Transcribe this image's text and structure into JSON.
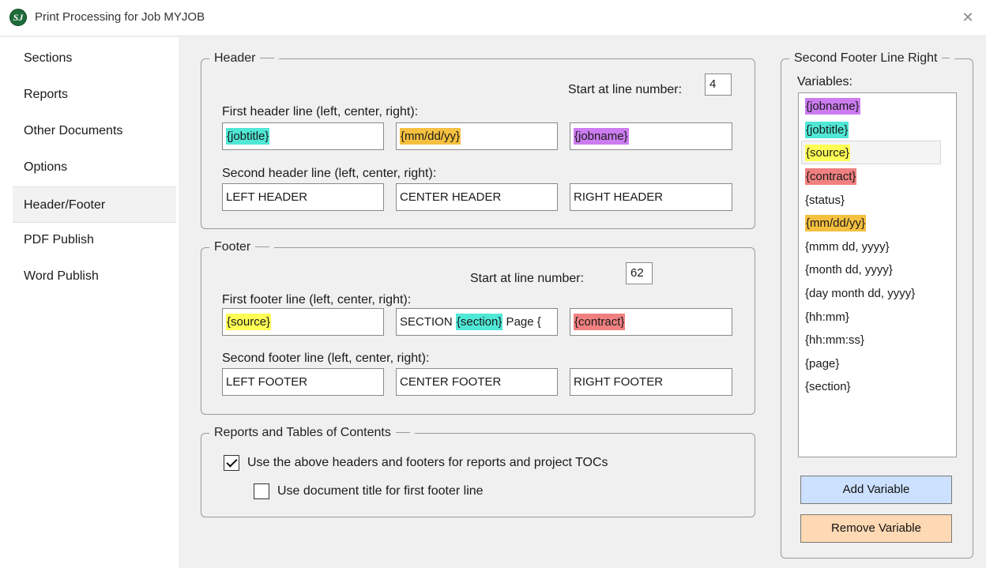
{
  "window": {
    "title": "Print Processing for Job MYJOB",
    "app_icon_text": "SJ",
    "close_glyph": "✕"
  },
  "sidebar": {
    "items": [
      {
        "label": "Sections"
      },
      {
        "label": "Reports"
      },
      {
        "label": "Other Documents"
      },
      {
        "label": "Options"
      },
      {
        "label": "Header/Footer"
      },
      {
        "label": "PDF Publish"
      },
      {
        "label": "Word Publish"
      }
    ],
    "active": "Header/Footer"
  },
  "colors": {
    "jobname": "#cc7cf0",
    "jobtitle": "#4fe8d6",
    "source": "#ffff55",
    "contract": "#f08080",
    "date": "#f5c040",
    "add_button": "#cce0ff",
    "remove_button": "#ffd9b3"
  },
  "header": {
    "legend": "Header",
    "start_label": "Start at line number:",
    "start_value": "4",
    "first_line_label": "First header line (left, center, right):",
    "first_left": "{jobtitle}",
    "first_center": "{mm/dd/yy}",
    "first_right": "{jobname}",
    "second_line_label": "Second header line (left, center, right):",
    "second_left": "LEFT HEADER",
    "second_center": "CENTER HEADER",
    "second_right": "RIGHT HEADER"
  },
  "footer": {
    "legend": "Footer",
    "start_label": "Start at line number:",
    "start_value": "62",
    "first_line_label": "First footer line (left, center, right):",
    "first_left": "{source}",
    "first_center_prefix": "SECTION ",
    "first_center_var": "{section}",
    "first_center_suffix": " Page {",
    "first_right": "{contract}",
    "second_line_label": "Second footer line (left, center, right):",
    "second_left": "LEFT FOOTER",
    "second_center": "CENTER FOOTER",
    "second_right": "RIGHT FOOTER"
  },
  "reports_toc": {
    "legend": "Reports and Tables of Contents",
    "use_headers_label": "Use the above headers and footers for reports and project TOCs",
    "use_headers_checked": true,
    "use_doc_title_label": "Use document title for first footer line",
    "use_doc_title_checked": false
  },
  "variables_panel": {
    "legend": "Second Footer Line Right",
    "variables_label": "Variables:",
    "items": [
      "{jobname}",
      "{jobtitle}",
      "{source}",
      "{contract}",
      "{status}",
      "{mm/dd/yy}",
      "{mmm dd, yyyy}",
      "{month dd, yyyy}",
      "{day month dd, yyyy}",
      "{hh:mm}",
      "{hh:mm:ss}",
      "{page}",
      "{section}"
    ],
    "selected": "{source}",
    "add_button": "Add Variable",
    "remove_button": "Remove Variable"
  }
}
